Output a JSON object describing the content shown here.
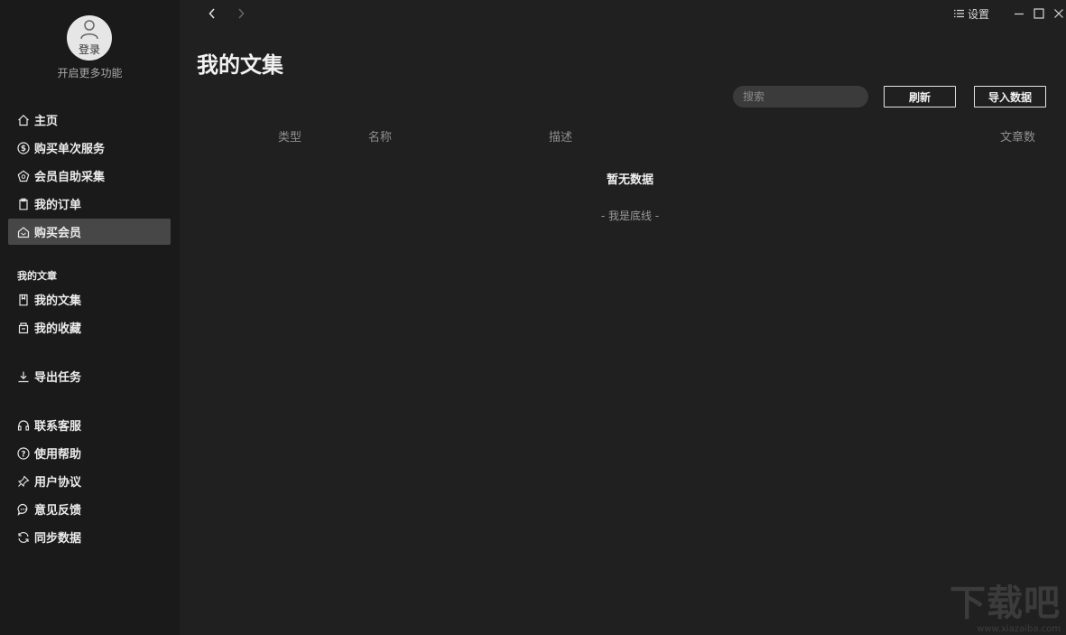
{
  "user": {
    "login_label": "登录",
    "subtitle": "开启更多功能"
  },
  "sidebar": {
    "items": [
      {
        "label": "主页",
        "icon": "home-icon"
      },
      {
        "label": "购买单次服务",
        "icon": "dollar-circle-icon"
      },
      {
        "label": "会员自助采集",
        "icon": "pentagon-icon"
      },
      {
        "label": "我的订单",
        "icon": "order-clipboard-icon"
      },
      {
        "label": "购买会员",
        "icon": "vip-house-icon",
        "active": true
      }
    ],
    "section_title": "我的文章",
    "article_items": [
      {
        "label": "我的文集",
        "icon": "book-icon"
      },
      {
        "label": "我的收藏",
        "icon": "collection-box-icon"
      }
    ],
    "export_item": {
      "label": "导出任务",
      "icon": "download-icon"
    },
    "support_items": [
      {
        "label": "联系客服",
        "icon": "headset-icon"
      },
      {
        "label": "使用帮助",
        "icon": "question-circle-icon"
      },
      {
        "label": "用户协议",
        "icon": "pin-icon"
      },
      {
        "label": "意见反馈",
        "icon": "chat-bubble-icon"
      },
      {
        "label": "同步数据",
        "icon": "sync-icon"
      }
    ]
  },
  "titlebar": {
    "settings_label": "设置"
  },
  "page": {
    "title": "我的文集",
    "search_placeholder": "搜索",
    "refresh_label": "刷新",
    "import_label": "导入数据",
    "columns": [
      "类型",
      "名称",
      "描述",
      "文章数"
    ],
    "empty_text": "暂无数据",
    "bottom_text": "- 我是底线 -"
  },
  "watermark": {
    "main": "下载吧",
    "sub": "www.xiazaiba.com"
  },
  "colors": {
    "sidebar_bg": "#1a1a1a",
    "main_bg": "#202020",
    "active_item": "#474747"
  }
}
